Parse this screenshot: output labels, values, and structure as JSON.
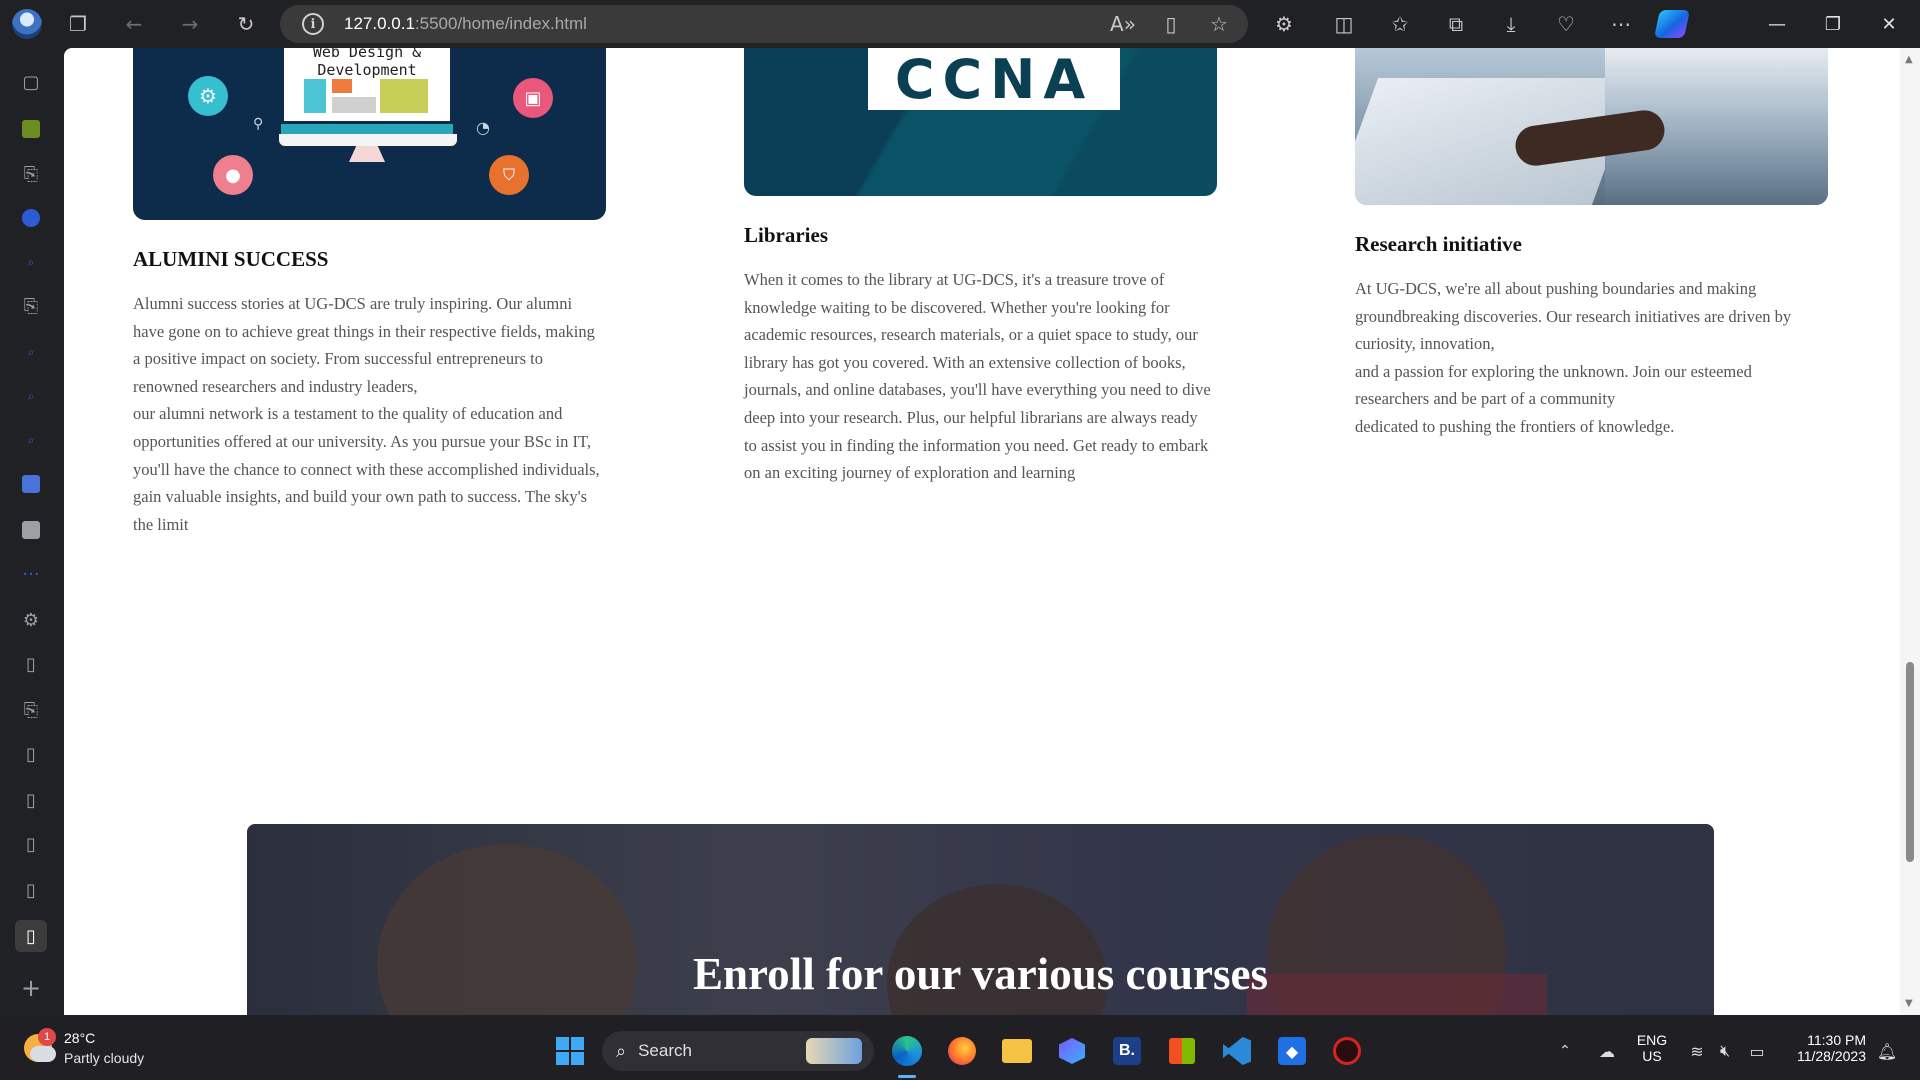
{
  "browser": {
    "url_host": "127.0.0.1",
    "url_path": ":5500/home/index.html"
  },
  "page": {
    "alumni_img_line1": "Web Design &",
    "alumni_img_line2": "Development",
    "ccna_label": "CCNA",
    "cards": [
      {
        "title": "ALUMINI SUCCESS",
        "text": "Alumni success stories at UG-DCS are truly inspiring. Our alumni have gone on to achieve great things in their respective fields, making a positive impact on society. From successful entrepreneurs to renowned researchers and industry leaders,\nour alumni network is a testament to the quality of education and opportunities offered at our university. As you pursue your BSc in IT, you'll have the chance to connect with these accomplished individuals, gain valuable insights, and build your own path to success. The sky's the limit"
      },
      {
        "title": "Libraries",
        "text": "When it comes to the library at UG-DCS, it's a treasure trove of knowledge waiting to be discovered. Whether you're looking for academic resources, research materials, or a quiet space to study, our library has got you covered. With an extensive collection of books, journals, and online databases, you'll have everything you need to dive deep into your research. Plus, our helpful librarians are always ready to assist you in finding the information you need. Get ready to embark on an exciting journey of exploration and learning"
      },
      {
        "title": "Research initiative",
        "text": "At UG-DCS, we're all about pushing boundaries and making groundbreaking discoveries. Our research initiatives are driven by curiosity, innovation,\nand a passion for exploring the unknown. Join our esteemed researchers and be part of a community\ndedicated to pushing the frontiers of knowledge."
      }
    ],
    "enroll_title": "Enroll for our various courses"
  },
  "taskbar": {
    "weather_temp": "28°C",
    "weather_desc": "Partly cloudy",
    "weather_badge": "1",
    "search_label": "Search",
    "lang_line1": "ENG",
    "lang_line2": "US",
    "time": "11:30 PM",
    "date": "11/28/2023"
  },
  "colors": {
    "accent_blue": "#1565e0",
    "page_bg": "#ffffff",
    "chrome_bg": "#202124"
  }
}
